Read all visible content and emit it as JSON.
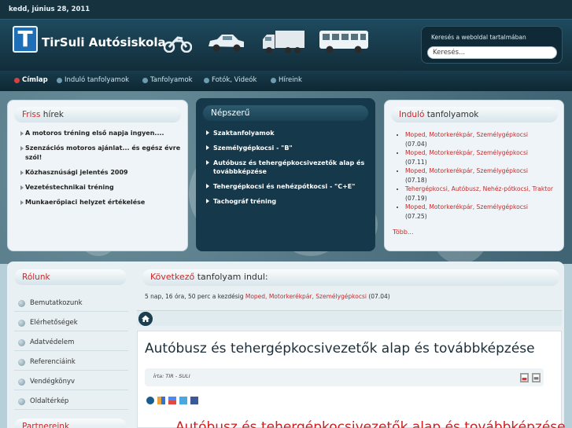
{
  "topbar": {
    "date": "kedd, június 28, 2011"
  },
  "header": {
    "logo_letter": "T",
    "logo_text": "TirSuli Autósiskola",
    "search_label": "Keresés a weboldal tartalmában",
    "search_value": "Keresés..."
  },
  "nav": {
    "items": [
      "Címlap",
      "Induló tanfolyamok",
      "Tanfolyamok",
      "Fotók, Videók",
      "Híreink"
    ],
    "active": "Címlap"
  },
  "news": {
    "title_highlight": "Friss",
    "title_rest": " hírek",
    "items": [
      "A motoros tréning első napja ingyen....",
      "Szenzációs motoros ajánlat... és egész évre szól!",
      "Közhasznúsági jelentés 2009",
      "Vezetéstechnikai tréning",
      "Munkaerőpiaci helyzet értékelése"
    ]
  },
  "popular": {
    "title": "Népszerű",
    "items": [
      "Szaktanfolyamok",
      "Személygépkocsi - \"B\"",
      "Autóbusz és tehergépkocsivezetők alap és továbbképzése",
      "Tehergépkocsi és nehézpótkocsi - \"C+E\"",
      "Tachográf tréning"
    ]
  },
  "courses": {
    "title_highlight": "Induló",
    "title_rest": " tanfolyamok",
    "items": [
      {
        "link": "Moped, Motorkerékpár, Személygépkocsi",
        "date": "(07.04)"
      },
      {
        "link": "Moped, Motorkerékpár, Személygépkocsi",
        "date": "(07.11)"
      },
      {
        "link": "Moped, Motorkerékpár, Személygépkocsi",
        "date": "(07.18)"
      },
      {
        "link": "Tehergépkocsi, Autóbusz, Nehéz-pótkocsi, Traktor",
        "date": "(07.19)"
      },
      {
        "link": "Moped, Motorkerékpár, Személygépkocsi",
        "date": "(07.25)"
      }
    ],
    "more": "Több..."
  },
  "about": {
    "title": "Rólunk",
    "items": [
      "Bemutatkozunk",
      "Elérhetőségek",
      "Adatvédelem",
      "Referenciáink",
      "Vendégkönyv",
      "Oldaltérkép"
    ],
    "partners_title": "Partnereink"
  },
  "next_course": {
    "title_highlight": "Következő",
    "title_rest": " tanfolyam indul:",
    "line_prefix": "5 nap, 16 óra, 50 perc a kezdésig ",
    "line_link": "Moped, Motorkerékpár, Személygépkocsi",
    "line_suffix": " (07.04)"
  },
  "article": {
    "title": "Autóbusz és tehergépkocsivezetők alap és továbbképzése",
    "author": "Írta: TIR - SULI",
    "title_repeat": "Autóbusz és tehergépkocsivezetők alap és továbbképzése"
  },
  "colors": {
    "accent_red": "#c62b2b",
    "header_dark": "#16323f",
    "logo_blue": "#1e6fb8"
  },
  "icons": [
    "pdf-icon",
    "print-icon",
    "share-digg-icon",
    "share-delicious-icon",
    "share-google-icon",
    "share-twitter-icon",
    "share-facebook-icon",
    "home-icon"
  ]
}
